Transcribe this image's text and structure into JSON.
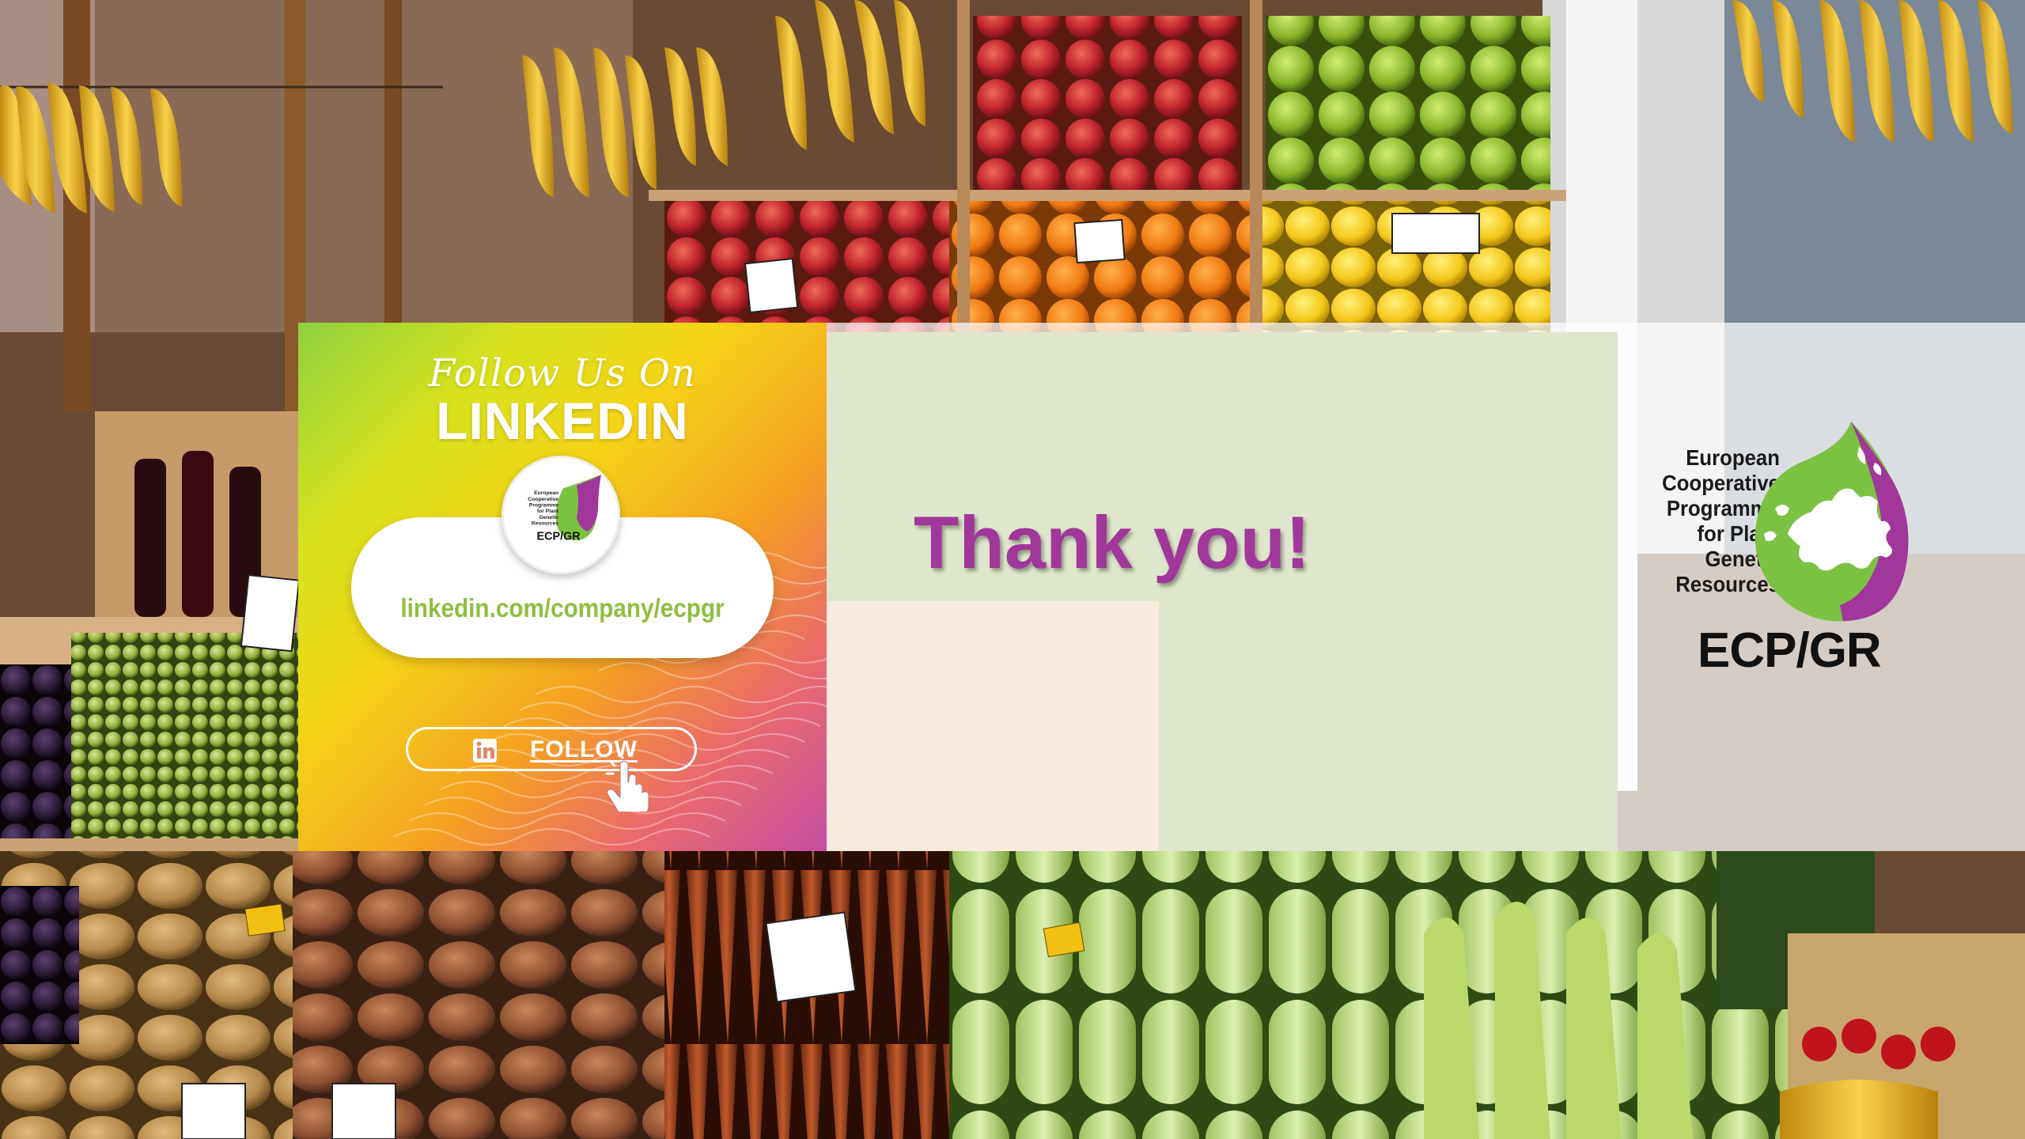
{
  "linkedin_card": {
    "follow_script": "Follow Us On",
    "heading": "LINKEDIN",
    "url": "linkedin.com/company/ecpgr",
    "follow_button_label": "FOLLOW",
    "logo_small_lines": [
      "European",
      "Cooperative",
      "Programme",
      "for Plant",
      "Genetic",
      "Resources"
    ],
    "logo_small_word": "ECP/GR"
  },
  "main": {
    "thank_you": "Thank you!"
  },
  "ecpgr_logo": {
    "lines": [
      "European",
      "Cooperative",
      "Programme",
      "for Plant",
      "Genetic",
      "Resources"
    ],
    "acronym": "ECP/GR",
    "leaf_green": "#7cc242",
    "leaf_purple": "#a1379a"
  },
  "icons": {
    "linkedin": "linkedin-icon",
    "pointer": "hand-pointer-icon"
  },
  "colors": {
    "thank_you": "#a1379a",
    "url_text": "#8dbf3f"
  }
}
